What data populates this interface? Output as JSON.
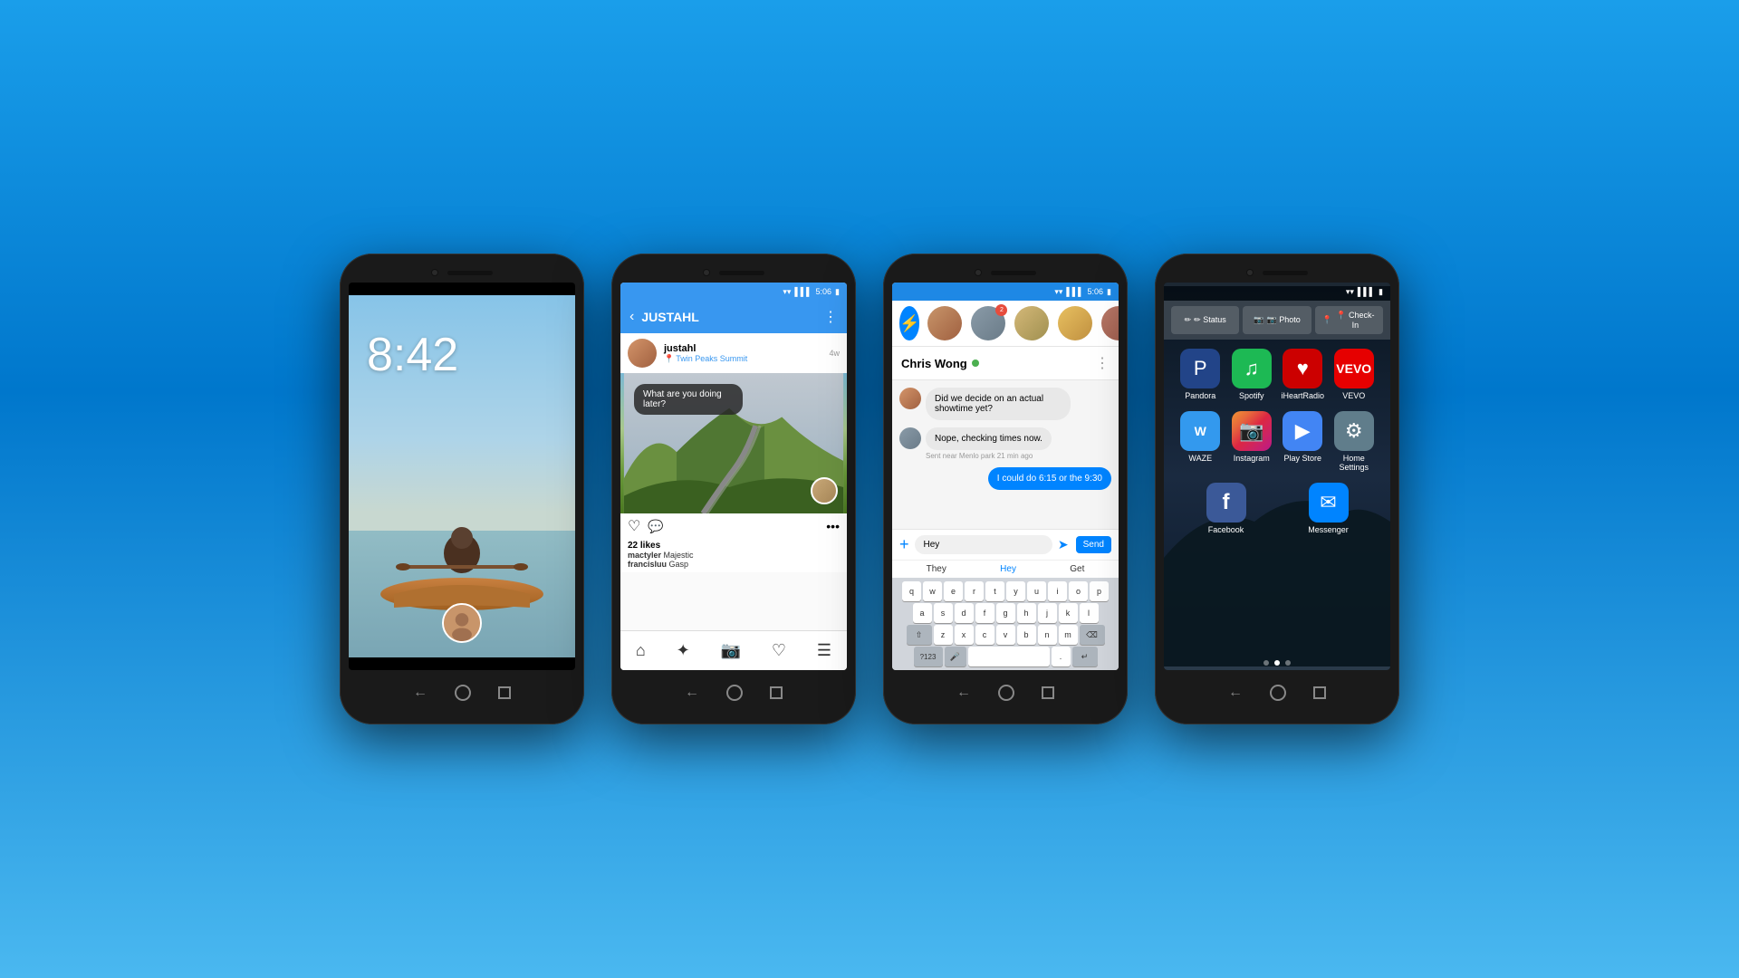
{
  "background": {
    "gradient_top": "#1a9eea",
    "gradient_bottom": "#4ab8f0"
  },
  "phone1": {
    "name": "lock-screen-phone",
    "time": "8:42",
    "avatar_alt": "user avatar"
  },
  "phone2": {
    "name": "instagram-phone",
    "status_bar": {
      "time": "5:06",
      "wifi": true,
      "signal": true,
      "battery": true
    },
    "header": {
      "back_label": "‹",
      "username": "JUSTAHL",
      "more_label": "⋮"
    },
    "post": {
      "user": "justahl",
      "location": "Twin Peaks Summit",
      "time": "4w",
      "chat_bubble": "What are you doing later?",
      "likes": "22 likes",
      "comments": [
        {
          "user": "mactyler",
          "text": "Majestic"
        },
        {
          "user": "francisluu",
          "text": "Gasp"
        }
      ]
    },
    "nav": {
      "items": [
        "⌂",
        "✦",
        "📷",
        "♡",
        "☰"
      ]
    }
  },
  "phone3": {
    "name": "messenger-phone",
    "status_bar": {
      "time": "5:06"
    },
    "contact_name": "Chris Wong",
    "online": true,
    "messages": [
      {
        "type": "incoming",
        "text": "Did we decide on an actual showtime yet?"
      },
      {
        "type": "outgoing_other",
        "text": "Nope, checking times now.",
        "sub": "Sent near Menlo park 21 min ago"
      },
      {
        "type": "outgoing",
        "text": "I could do 6:15 or the 9:30"
      }
    ],
    "input": {
      "value": "Hey",
      "send_label": "Send"
    },
    "autocomplete": [
      "They",
      "Hey",
      "Get"
    ],
    "keyboard": {
      "rows": [
        [
          "q",
          "w",
          "e",
          "r",
          "t",
          "y",
          "u",
          "i",
          "o",
          "p"
        ],
        [
          "a",
          "s",
          "d",
          "f",
          "g",
          "h",
          "j",
          "k",
          "l"
        ],
        [
          "⇧",
          "z",
          "x",
          "c",
          "v",
          "b",
          "n",
          "m",
          "⌫"
        ],
        [
          "?123",
          "🎤",
          "",
          "",
          "",
          " ",
          "",
          ".",
          "↵"
        ]
      ]
    }
  },
  "phone4": {
    "name": "facebook-home-phone",
    "compose_bar": {
      "status_label": "✏ Status",
      "photo_label": "📷 Photo",
      "checkin_label": "📍 Check-In"
    },
    "apps": [
      [
        {
          "name": "Pandora",
          "icon": "P",
          "class": "icon-pandora"
        },
        {
          "name": "Spotify",
          "icon": "♫",
          "class": "icon-spotify"
        },
        {
          "name": "iHeartRadio",
          "icon": "♥",
          "class": "icon-iheartradio"
        },
        {
          "name": "VEVO",
          "icon": "V",
          "class": "icon-vevo"
        }
      ],
      [
        {
          "name": "WAZE",
          "icon": "W",
          "class": "icon-waze"
        },
        {
          "name": "Instagram",
          "icon": "📷",
          "class": "icon-instagram"
        },
        {
          "name": "Play Store",
          "icon": "▶",
          "class": "icon-playstore"
        },
        {
          "name": "Home Settings",
          "icon": "⚙",
          "class": "icon-settings"
        }
      ],
      [
        {
          "name": "Facebook",
          "icon": "f",
          "class": "icon-facebook"
        },
        {
          "name": "Messenger",
          "icon": "✉",
          "class": "icon-messenger"
        }
      ]
    ],
    "dots": 3,
    "active_dot": 1
  }
}
